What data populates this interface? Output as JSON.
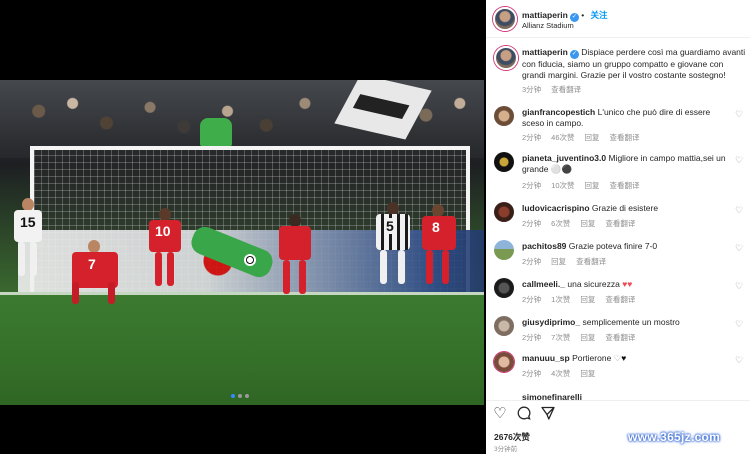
{
  "post": {
    "username": "mattiaperin",
    "follow_label": "关注",
    "location": "Allianz Stadium",
    "caption": "Dispiace perdere così ma guardiamo avanti con fiducia, siamo un gruppo compatto e giovane con grandi margini. Grazie per il vostro costante sostegno!",
    "caption_time": "3分钟",
    "see_translation": "查看翻译"
  },
  "comments": [
    {
      "user": "gianfrancopestich",
      "text": "L'unico che può dire di essere sceso in campo.",
      "time": "2分钟",
      "likes": "46次赞",
      "reply": "回复",
      "translate": "查看翻译"
    },
    {
      "user": "pianeta_juventino3.0",
      "text": "Migliore in campo mattia,sei un grande",
      "time": "2分钟",
      "likes": "10次赞",
      "reply": "回复",
      "translate": "查看翻译"
    },
    {
      "user": "ludovicacrispino",
      "text": "Grazie di esistere",
      "time": "2分钟",
      "likes": "6次赞",
      "reply": "回复",
      "translate": "查看翻译"
    },
    {
      "user": "pachitos89",
      "text": "Grazie poteva finire 7-0",
      "time": "2分钟",
      "likes": "",
      "reply": "回复",
      "translate": "查看翻译"
    },
    {
      "user": "callmeeli._",
      "text": "una sicurezza",
      "time": "2分钟",
      "likes": "1次赞",
      "reply": "回复",
      "translate": "查看翻译"
    },
    {
      "user": "giusydiprimo_",
      "text": "semplicemente un mostro",
      "time": "2分钟",
      "likes": "7次赞",
      "reply": "回复",
      "translate": "查看翻译"
    },
    {
      "user": "manuuu_sp",
      "text": "Portierone",
      "time": "2分钟",
      "likes": "4次赞",
      "reply": "回复",
      "translate": ""
    },
    {
      "user": "simonefinarelli",
      "text": "",
      "time": "",
      "likes": "",
      "reply": "",
      "translate": ""
    }
  ],
  "footer": {
    "likes": "2676次赞",
    "time": "3分钟前"
  },
  "photo": {
    "player_numbers": [
      "15",
      "10",
      "7",
      "8",
      "5"
    ]
  },
  "icons": [
    "heart-icon",
    "comment-icon",
    "share-icon",
    "verified-icon"
  ],
  "watermark": "www.365jz.com",
  "colors": {
    "accent": "#0095f6",
    "heart": "#ed4956",
    "meta": "#8e8e8e"
  }
}
